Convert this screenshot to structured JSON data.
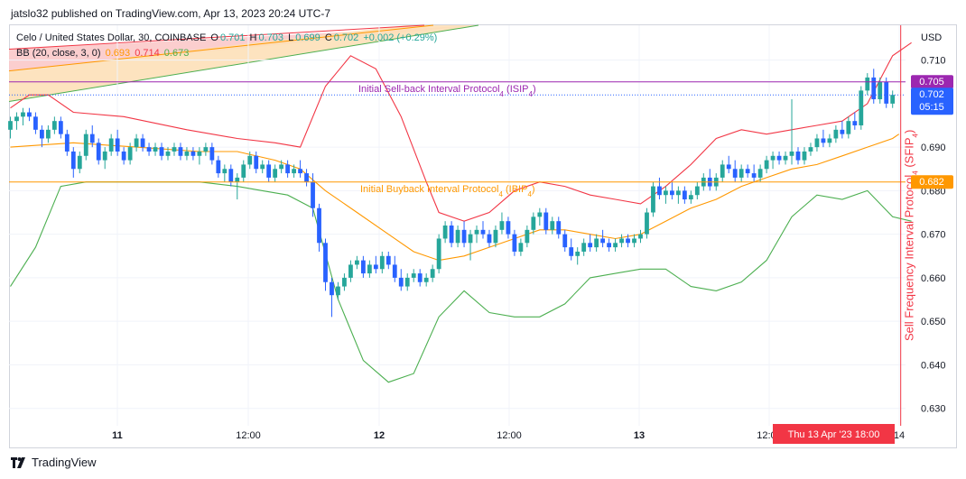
{
  "header": {
    "published": "jatslo32 published on TradingView.com, Apr 13, 2023 20:24 UTC-7"
  },
  "legend": {
    "symbol": "Celo / United States Dollar, 30, COINBASE",
    "o_label": "O",
    "o": "0.701",
    "h_label": "H",
    "h": "0.703",
    "l_label": "L",
    "l": "0.699",
    "c_label": "C",
    "c": "0.702",
    "change": "+0.002 (+0.29%)",
    "bb_label": "BB (20, close, 3, 0)",
    "bb_basis": "0.693",
    "bb_upper": "0.714",
    "bb_lower": "0.673"
  },
  "footer": {
    "brand": "TradingView"
  },
  "colors": {
    "up": "#26a69a",
    "down": "#2962ff",
    "basis": "#ff9800",
    "upper": "#f23645",
    "lower": "#4caf50",
    "sell_line": "#9c27b0",
    "buy_line": "#ff9800",
    "vline": "#f23645"
  },
  "chart_data": {
    "type": "candlestick",
    "currency": "USD",
    "y_axis": {
      "min": 0.626,
      "max": 0.718,
      "ticks": [
        "0.710",
        "0.690",
        "0.680",
        "0.670",
        "0.660",
        "0.650",
        "0.640",
        "0.630"
      ]
    },
    "x_ticks": [
      "11",
      "12:00",
      "12",
      "12:00",
      "13",
      "12:00",
      "14"
    ],
    "bold_x_ticks": [
      "11",
      "12",
      "13"
    ],
    "cursor_label": "Thu 13 Apr '23   18:00",
    "price_labels": [
      {
        "text": "0.705",
        "value": 0.705,
        "color": "#9c27b0"
      },
      {
        "text": "0.702",
        "sub": "05:15",
        "value": 0.702,
        "color": "#2962ff"
      },
      {
        "text": "0.682",
        "value": 0.682,
        "color": "#ff9800"
      }
    ],
    "annotations": {
      "sell_back": {
        "text": "Initial Sell-back Interval Protocol",
        "sub": "4",
        "tail": " (ISIP",
        "sub2": "4",
        "end": ")",
        "value": 0.705
      },
      "buyback": {
        "text": "Initial Buyback Interval Protocol",
        "sub": "4",
        "tail": " (IBIP",
        "sub2": "4",
        "end": ")",
        "value": 0.682
      },
      "sell_freq": {
        "text": "Sell Frequency Interval Protocol",
        "sub": "4",
        "tail": " (SFIP",
        "sub2": "4",
        "end": ")",
        "time_index": 141
      }
    },
    "candles": [
      [
        0.694,
        0.697,
        0.692,
        0.696
      ],
      [
        0.696,
        0.698,
        0.694,
        0.697
      ],
      [
        0.697,
        0.699,
        0.695,
        0.698
      ],
      [
        0.698,
        0.699,
        0.696,
        0.697
      ],
      [
        0.697,
        0.698,
        0.693,
        0.694
      ],
      [
        0.694,
        0.695,
        0.69,
        0.692
      ],
      [
        0.692,
        0.695,
        0.691,
        0.694
      ],
      [
        0.694,
        0.697,
        0.693,
        0.696
      ],
      [
        0.696,
        0.697,
        0.692,
        0.693
      ],
      [
        0.693,
        0.694,
        0.688,
        0.689
      ],
      [
        0.689,
        0.69,
        0.683,
        0.685
      ],
      [
        0.685,
        0.689,
        0.684,
        0.688
      ],
      [
        0.688,
        0.694,
        0.687,
        0.693
      ],
      [
        0.693,
        0.695,
        0.69,
        0.691
      ],
      [
        0.691,
        0.692,
        0.686,
        0.687
      ],
      [
        0.687,
        0.69,
        0.685,
        0.689
      ],
      [
        0.689,
        0.693,
        0.688,
        0.692
      ],
      [
        0.692,
        0.694,
        0.688,
        0.689
      ],
      [
        0.689,
        0.69,
        0.686,
        0.687
      ],
      [
        0.687,
        0.691,
        0.686,
        0.69
      ],
      [
        0.69,
        0.693,
        0.689,
        0.692
      ],
      [
        0.692,
        0.693,
        0.689,
        0.69
      ],
      [
        0.69,
        0.691,
        0.688,
        0.689
      ],
      [
        0.689,
        0.691,
        0.688,
        0.69
      ],
      [
        0.69,
        0.691,
        0.687,
        0.688
      ],
      [
        0.688,
        0.69,
        0.687,
        0.689
      ],
      [
        0.689,
        0.691,
        0.688,
        0.69
      ],
      [
        0.69,
        0.691,
        0.687,
        0.688
      ],
      [
        0.688,
        0.69,
        0.687,
        0.689
      ],
      [
        0.689,
        0.69,
        0.687,
        0.688
      ],
      [
        0.688,
        0.69,
        0.686,
        0.689
      ],
      [
        0.689,
        0.691,
        0.688,
        0.69
      ],
      [
        0.69,
        0.691,
        0.686,
        0.687
      ],
      [
        0.687,
        0.688,
        0.683,
        0.684
      ],
      [
        0.684,
        0.686,
        0.682,
        0.685
      ],
      [
        0.685,
        0.686,
        0.681,
        0.682
      ],
      [
        0.682,
        0.684,
        0.678,
        0.683
      ],
      [
        0.683,
        0.687,
        0.682,
        0.686
      ],
      [
        0.686,
        0.689,
        0.685,
        0.688
      ],
      [
        0.688,
        0.689,
        0.684,
        0.685
      ],
      [
        0.685,
        0.687,
        0.684,
        0.686
      ],
      [
        0.686,
        0.687,
        0.682,
        0.683
      ],
      [
        0.683,
        0.686,
        0.682,
        0.685
      ],
      [
        0.685,
        0.687,
        0.684,
        0.686
      ],
      [
        0.686,
        0.687,
        0.683,
        0.684
      ],
      [
        0.684,
        0.686,
        0.683,
        0.685
      ],
      [
        0.685,
        0.687,
        0.683,
        0.684
      ],
      [
        0.684,
        0.685,
        0.681,
        0.682
      ],
      [
        0.682,
        0.684,
        0.674,
        0.676
      ],
      [
        0.676,
        0.677,
        0.666,
        0.668
      ],
      [
        0.668,
        0.669,
        0.657,
        0.659
      ],
      [
        0.659,
        0.66,
        0.651,
        0.656
      ],
      [
        0.656,
        0.659,
        0.655,
        0.658
      ],
      [
        0.658,
        0.661,
        0.657,
        0.66
      ],
      [
        0.66,
        0.664,
        0.659,
        0.663
      ],
      [
        0.663,
        0.665,
        0.662,
        0.664
      ],
      [
        0.664,
        0.665,
        0.66,
        0.661
      ],
      [
        0.661,
        0.664,
        0.66,
        0.663
      ],
      [
        0.663,
        0.665,
        0.661,
        0.662
      ],
      [
        0.662,
        0.666,
        0.661,
        0.665
      ],
      [
        0.665,
        0.666,
        0.662,
        0.663
      ],
      [
        0.663,
        0.665,
        0.659,
        0.66
      ],
      [
        0.66,
        0.662,
        0.657,
        0.658
      ],
      [
        0.658,
        0.661,
        0.657,
        0.66
      ],
      [
        0.66,
        0.662,
        0.659,
        0.661
      ],
      [
        0.661,
        0.662,
        0.658,
        0.659
      ],
      [
        0.659,
        0.661,
        0.658,
        0.66
      ],
      [
        0.66,
        0.663,
        0.659,
        0.662
      ],
      [
        0.662,
        0.67,
        0.661,
        0.669
      ],
      [
        0.669,
        0.673,
        0.668,
        0.672
      ],
      [
        0.672,
        0.673,
        0.667,
        0.668
      ],
      [
        0.668,
        0.672,
        0.667,
        0.671
      ],
      [
        0.671,
        0.673,
        0.667,
        0.668
      ],
      [
        0.668,
        0.671,
        0.664,
        0.67
      ],
      [
        0.67,
        0.672,
        0.668,
        0.671
      ],
      [
        0.671,
        0.673,
        0.669,
        0.67
      ],
      [
        0.67,
        0.671,
        0.667,
        0.668
      ],
      [
        0.668,
        0.672,
        0.667,
        0.671
      ],
      [
        0.671,
        0.675,
        0.67,
        0.673
      ],
      [
        0.673,
        0.674,
        0.669,
        0.67
      ],
      [
        0.67,
        0.671,
        0.665,
        0.666
      ],
      [
        0.666,
        0.669,
        0.665,
        0.668
      ],
      [
        0.668,
        0.672,
        0.667,
        0.671
      ],
      [
        0.671,
        0.675,
        0.67,
        0.674
      ],
      [
        0.674,
        0.676,
        0.672,
        0.675
      ],
      [
        0.675,
        0.676,
        0.67,
        0.671
      ],
      [
        0.671,
        0.674,
        0.67,
        0.673
      ],
      [
        0.673,
        0.674,
        0.669,
        0.67
      ],
      [
        0.67,
        0.671,
        0.666,
        0.667
      ],
      [
        0.667,
        0.669,
        0.664,
        0.665
      ],
      [
        0.665,
        0.667,
        0.663,
        0.666
      ],
      [
        0.666,
        0.669,
        0.665,
        0.668
      ],
      [
        0.668,
        0.67,
        0.666,
        0.667
      ],
      [
        0.667,
        0.67,
        0.666,
        0.669
      ],
      [
        0.669,
        0.671,
        0.667,
        0.668
      ],
      [
        0.668,
        0.669,
        0.666,
        0.667
      ],
      [
        0.667,
        0.669,
        0.666,
        0.668
      ],
      [
        0.668,
        0.67,
        0.667,
        0.669
      ],
      [
        0.669,
        0.67,
        0.667,
        0.668
      ],
      [
        0.668,
        0.67,
        0.667,
        0.669
      ],
      [
        0.669,
        0.671,
        0.668,
        0.67
      ],
      [
        0.67,
        0.676,
        0.669,
        0.675
      ],
      [
        0.675,
        0.682,
        0.674,
        0.681
      ],
      [
        0.681,
        0.683,
        0.678,
        0.679
      ],
      [
        0.679,
        0.681,
        0.677,
        0.68
      ],
      [
        0.68,
        0.682,
        0.678,
        0.679
      ],
      [
        0.679,
        0.681,
        0.677,
        0.68
      ],
      [
        0.68,
        0.681,
        0.677,
        0.678
      ],
      [
        0.678,
        0.68,
        0.677,
        0.679
      ],
      [
        0.679,
        0.682,
        0.678,
        0.681
      ],
      [
        0.681,
        0.684,
        0.68,
        0.683
      ],
      [
        0.683,
        0.685,
        0.68,
        0.681
      ],
      [
        0.681,
        0.684,
        0.68,
        0.683
      ],
      [
        0.683,
        0.687,
        0.682,
        0.686
      ],
      [
        0.686,
        0.688,
        0.684,
        0.685
      ],
      [
        0.685,
        0.687,
        0.682,
        0.683
      ],
      [
        0.683,
        0.686,
        0.682,
        0.685
      ],
      [
        0.685,
        0.686,
        0.683,
        0.684
      ],
      [
        0.684,
        0.686,
        0.682,
        0.683
      ],
      [
        0.683,
        0.686,
        0.682,
        0.685
      ],
      [
        0.685,
        0.688,
        0.684,
        0.687
      ],
      [
        0.687,
        0.689,
        0.685,
        0.688
      ],
      [
        0.688,
        0.689,
        0.686,
        0.687
      ],
      [
        0.687,
        0.689,
        0.686,
        0.688
      ],
      [
        0.688,
        0.701,
        0.686,
        0.689
      ],
      [
        0.689,
        0.69,
        0.686,
        0.687
      ],
      [
        0.687,
        0.69,
        0.686,
        0.689
      ],
      [
        0.689,
        0.691,
        0.688,
        0.69
      ],
      [
        0.69,
        0.693,
        0.689,
        0.692
      ],
      [
        0.692,
        0.694,
        0.69,
        0.691
      ],
      [
        0.691,
        0.693,
        0.69,
        0.692
      ],
      [
        0.692,
        0.695,
        0.691,
        0.694
      ],
      [
        0.694,
        0.696,
        0.692,
        0.693
      ],
      [
        0.693,
        0.697,
        0.692,
        0.696
      ],
      [
        0.696,
        0.698,
        0.694,
        0.695
      ],
      [
        0.695,
        0.704,
        0.694,
        0.703
      ],
      [
        0.703,
        0.707,
        0.702,
        0.706
      ],
      [
        0.706,
        0.708,
        0.7,
        0.701
      ],
      [
        0.701,
        0.706,
        0.7,
        0.705
      ],
      [
        0.705,
        0.706,
        0.699,
        0.7
      ],
      [
        0.7,
        0.703,
        0.699,
        0.702
      ]
    ],
    "bb_basis": [
      [
        0,
        0.69
      ],
      [
        10,
        0.691
      ],
      [
        20,
        0.69
      ],
      [
        30,
        0.689
      ],
      [
        36,
        0.689
      ],
      [
        42,
        0.687
      ],
      [
        46,
        0.685
      ],
      [
        50,
        0.68
      ],
      [
        55,
        0.675
      ],
      [
        60,
        0.67
      ],
      [
        64,
        0.666
      ],
      [
        68,
        0.664
      ],
      [
        72,
        0.665
      ],
      [
        76,
        0.667
      ],
      [
        80,
        0.669
      ],
      [
        84,
        0.671
      ],
      [
        88,
        0.671
      ],
      [
        92,
        0.67
      ],
      [
        96,
        0.669
      ],
      [
        100,
        0.67
      ],
      [
        104,
        0.673
      ],
      [
        108,
        0.676
      ],
      [
        112,
        0.678
      ],
      [
        116,
        0.681
      ],
      [
        120,
        0.683
      ],
      [
        124,
        0.685
      ],
      [
        128,
        0.686
      ],
      [
        132,
        0.688
      ],
      [
        136,
        0.69
      ],
      [
        140,
        0.692
      ],
      [
        141,
        0.693
      ]
    ],
    "bb_upper": [
      [
        0,
        0.699
      ],
      [
        3,
        0.702
      ],
      [
        6,
        0.702
      ],
      [
        10,
        0.698
      ],
      [
        18,
        0.697
      ],
      [
        28,
        0.694
      ],
      [
        36,
        0.692
      ],
      [
        42,
        0.691
      ],
      [
        46,
        0.69
      ],
      [
        50,
        0.704
      ],
      [
        54,
        0.711
      ],
      [
        58,
        0.708
      ],
      [
        62,
        0.697
      ],
      [
        66,
        0.682
      ],
      [
        68,
        0.675
      ],
      [
        72,
        0.673
      ],
      [
        76,
        0.675
      ],
      [
        80,
        0.68
      ],
      [
        84,
        0.682
      ],
      [
        88,
        0.681
      ],
      [
        92,
        0.679
      ],
      [
        96,
        0.678
      ],
      [
        100,
        0.677
      ],
      [
        104,
        0.681
      ],
      [
        108,
        0.686
      ],
      [
        112,
        0.692
      ],
      [
        116,
        0.694
      ],
      [
        120,
        0.693
      ],
      [
        124,
        0.694
      ],
      [
        128,
        0.695
      ],
      [
        132,
        0.696
      ],
      [
        136,
        0.7
      ],
      [
        140,
        0.711
      ],
      [
        143,
        0.714
      ]
    ],
    "bb_lower": [
      [
        0,
        0.658
      ],
      [
        4,
        0.667
      ],
      [
        8,
        0.681
      ],
      [
        12,
        0.682
      ],
      [
        20,
        0.682
      ],
      [
        30,
        0.682
      ],
      [
        36,
        0.681
      ],
      [
        40,
        0.68
      ],
      [
        44,
        0.679
      ],
      [
        48,
        0.676
      ],
      [
        52,
        0.655
      ],
      [
        56,
        0.641
      ],
      [
        60,
        0.636
      ],
      [
        64,
        0.638
      ],
      [
        68,
        0.651
      ],
      [
        72,
        0.657
      ],
      [
        76,
        0.652
      ],
      [
        80,
        0.651
      ],
      [
        84,
        0.651
      ],
      [
        88,
        0.654
      ],
      [
        92,
        0.66
      ],
      [
        96,
        0.661
      ],
      [
        100,
        0.662
      ],
      [
        104,
        0.662
      ],
      [
        108,
        0.658
      ],
      [
        112,
        0.657
      ],
      [
        116,
        0.659
      ],
      [
        120,
        0.664
      ],
      [
        124,
        0.674
      ],
      [
        128,
        0.679
      ],
      [
        132,
        0.678
      ],
      [
        136,
        0.68
      ],
      [
        140,
        0.674
      ],
      [
        143,
        0.673
      ]
    ]
  }
}
